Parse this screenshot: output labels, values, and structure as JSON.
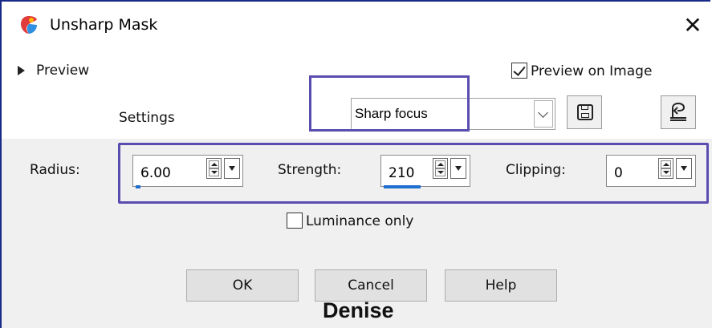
{
  "window": {
    "title": "Unsharp Mask",
    "close_glyph": "✕"
  },
  "preview": {
    "label": "Preview",
    "expanded": false
  },
  "preview_on_image": {
    "label": "Preview on Image",
    "checked": true
  },
  "settings": {
    "label": "Settings",
    "preset_value": "Sharp focus"
  },
  "params": {
    "radius": {
      "label": "Radius:",
      "value": "6.00"
    },
    "strength": {
      "label": "Strength:",
      "value": "210"
    },
    "clipping": {
      "label": "Clipping:",
      "value": "0"
    }
  },
  "luminance_only": {
    "label": "Luminance only",
    "checked": false
  },
  "buttons": {
    "ok": "OK",
    "cancel": "Cancel",
    "help": "Help"
  },
  "watermark": "Denise",
  "colors": {
    "accent": "#5a4db0",
    "slider": "#1f6fd0",
    "panel": "#f0f0f0",
    "border": "#1a2a8a"
  },
  "icons": {
    "app": "paintshop-pro-icon",
    "save": "save-icon",
    "reset": "reset-defaults-icon",
    "close": "close-icon",
    "expand": "triangle-right-icon"
  }
}
